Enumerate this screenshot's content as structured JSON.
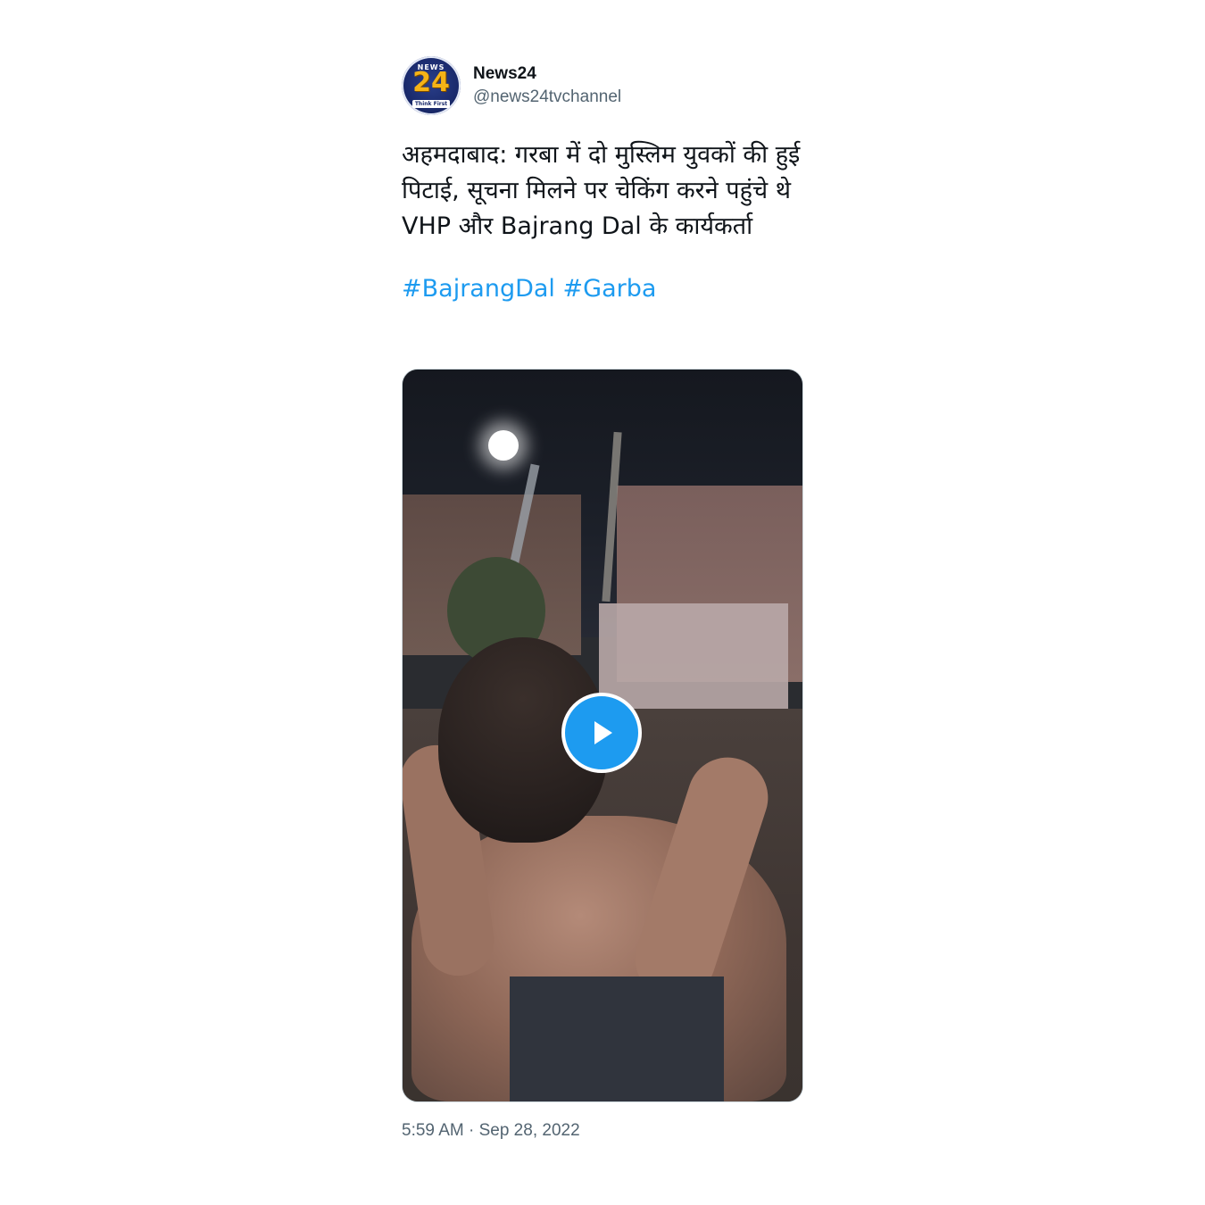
{
  "account": {
    "avatar_label_top": "NEWS",
    "avatar_label_number": "24",
    "avatar_label_tagline": "Think First",
    "display_name": "News24",
    "handle": "@news24tvchannel"
  },
  "tweet": {
    "text": "अहमदाबाद: गरबा में दो मुस्लिम युवकों की हुई पिटाई, सूचना मिलने पर चेकिंग करने पहुंचे थे VHP और Bajrang Dal के कार्यकर्ता",
    "hashtags": [
      "#BajrangDal",
      "#Garba"
    ],
    "timestamp": "5:59 AM · Sep 28, 2022"
  },
  "media": {
    "type": "video",
    "play_icon": "play-icon"
  },
  "colors": {
    "link": "#1d9bf0",
    "text": "#0f1419",
    "muted": "#536471",
    "border": "#cfd9de"
  }
}
